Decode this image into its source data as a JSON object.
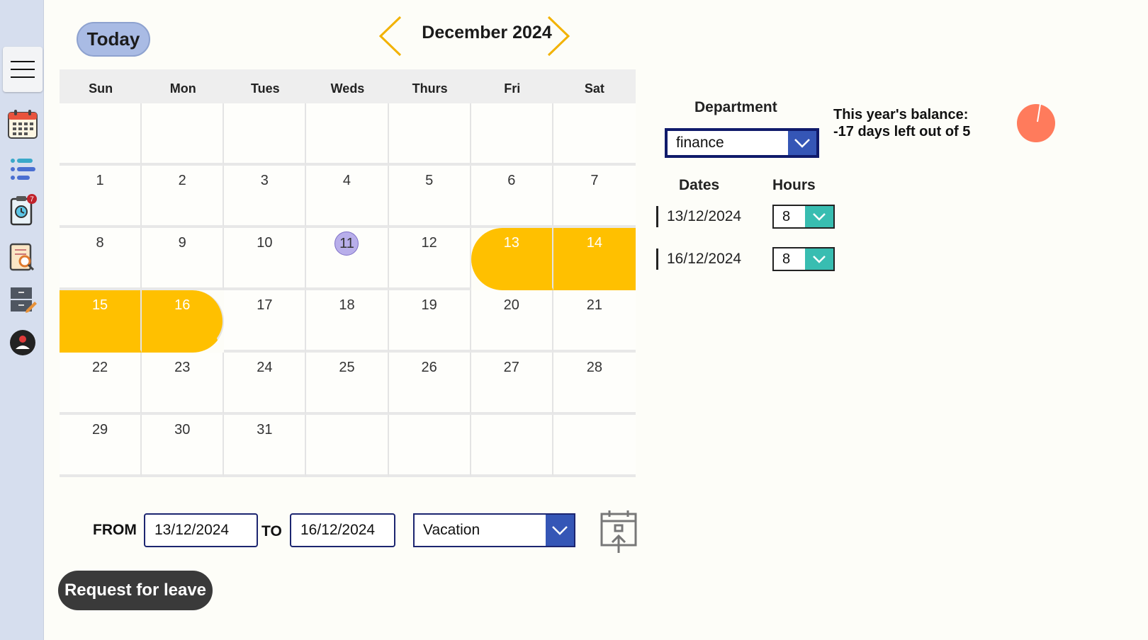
{
  "sidebar": {
    "items": [
      {
        "name": "menu-button",
        "icon": "hamburger-icon"
      },
      {
        "name": "calendar-nav",
        "icon": "calendar-icon"
      },
      {
        "name": "list-nav",
        "icon": "list-icon"
      },
      {
        "name": "requests-nav",
        "icon": "clipboard-clock-icon",
        "badge": "7"
      },
      {
        "name": "review-nav",
        "icon": "document-search-icon"
      },
      {
        "name": "archive-nav",
        "icon": "cabinet-edit-icon"
      },
      {
        "name": "profile-nav",
        "icon": "user-icon"
      }
    ]
  },
  "header": {
    "today_label": "Today",
    "month_title": "December 2024"
  },
  "calendar": {
    "weekdays": [
      "Sun",
      "Mon",
      "Tues",
      "Weds",
      "Thurs",
      "Fri",
      "Sat"
    ],
    "days": [
      "",
      "",
      "",
      "",
      "",
      "",
      "",
      "1",
      "2",
      "3",
      "4",
      "5",
      "6",
      "7",
      "8",
      "9",
      "10",
      "11",
      "12",
      "13",
      "14",
      "15",
      "16",
      "17",
      "18",
      "19",
      "20",
      "21",
      "22",
      "23",
      "24",
      "25",
      "26",
      "27",
      "28",
      "29",
      "30",
      "31",
      "",
      "",
      "",
      ""
    ],
    "today": "11",
    "selected": [
      "13",
      "14",
      "15",
      "16"
    ],
    "selection_color": "#ffc000",
    "today_color": "#b8aeea"
  },
  "department": {
    "label": "Department",
    "value": "finance"
  },
  "balance": {
    "line1": "This year's balance:",
    "line2": "-17 days left out of 5",
    "pie_color": "#ff7b5c"
  },
  "leave_days": {
    "dates_header": "Dates",
    "hours_header": "Hours",
    "rows": [
      {
        "date": "13/12/2024",
        "hours": "8"
      },
      {
        "date": "16/12/2024",
        "hours": "8"
      }
    ]
  },
  "request_form": {
    "from_label": "FROM",
    "from_value": "13/12/2024",
    "to_label": "TO",
    "to_value": "16/12/2024",
    "leave_type": "Vacation",
    "upload_icon": "calendar-upload-icon",
    "submit_label": "Request for leave"
  }
}
